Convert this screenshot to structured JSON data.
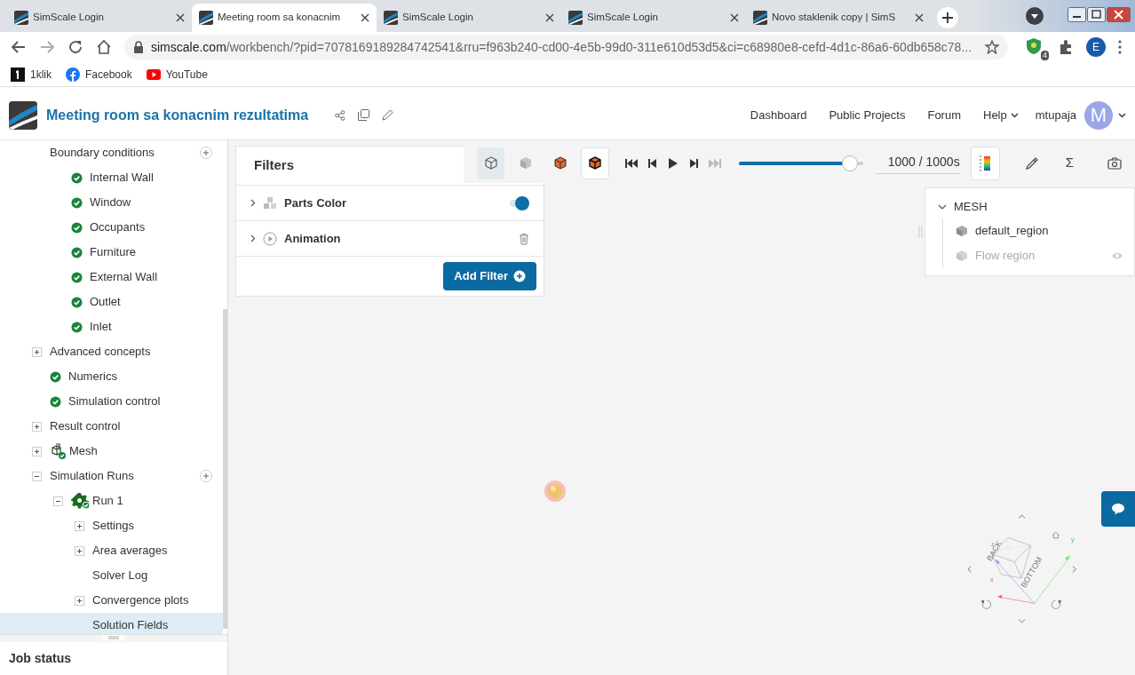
{
  "browser": {
    "tabs": [
      {
        "title": "SimScale Login",
        "selected": false
      },
      {
        "title": "Meeting room sa konacnim",
        "selected": true
      },
      {
        "title": "SimScale Login",
        "selected": false
      },
      {
        "title": "SimScale Login",
        "selected": false
      },
      {
        "title": "Novo staklenik copy | SimS",
        "selected": false
      }
    ],
    "url": "simscale.com/workbench/?pid=7078169189284742541&rru=f963b240-cd00-4e5b-99d0-311e610d53d5&ci=c68980e8-cefd-4d1c-86a6-60db658c78...",
    "extension_badge": "4",
    "profile_initial": "E",
    "bookmarks": [
      {
        "kind": "klik",
        "label": "1klik"
      },
      {
        "kind": "facebook",
        "label": "Facebook"
      },
      {
        "kind": "youtube",
        "label": "YouTube"
      }
    ]
  },
  "header": {
    "project_title": "Meeting room sa konacnim rezultatima",
    "nav": [
      {
        "label": "Dashboard",
        "dropdown": false
      },
      {
        "label": "Public Projects",
        "dropdown": false
      },
      {
        "label": "Forum",
        "dropdown": false
      },
      {
        "label": "Help",
        "dropdown": true
      }
    ],
    "username": "mtupaja",
    "avatar_initial": "M"
  },
  "sidebar": {
    "tree": [
      {
        "label": "Boundary conditions",
        "add_button": true,
        "selected": false,
        "children": [
          {
            "label": "Internal Wall",
            "kind": "done",
            "selected": false
          },
          {
            "label": "Window",
            "kind": "done",
            "selected": false
          },
          {
            "label": "Occupants",
            "kind": "done",
            "selected": false
          },
          {
            "label": "Furniture",
            "kind": "done",
            "selected": false
          },
          {
            "label": "External Wall",
            "kind": "done",
            "selected": false
          },
          {
            "label": "Outlet",
            "kind": "done",
            "selected": false
          },
          {
            "label": "Inlet",
            "kind": "done",
            "selected": false
          }
        ]
      },
      {
        "label": "Advanced concepts",
        "expanded": false,
        "selected": false
      },
      {
        "label": "Numerics",
        "kind": "done",
        "selected": false
      },
      {
        "label": "Simulation control",
        "kind": "done",
        "selected": false
      },
      {
        "label": "Result control",
        "expanded": false,
        "selected": false
      },
      {
        "label": "Mesh",
        "kind": "mesh",
        "expanded": false,
        "selected": false
      },
      {
        "label": "Simulation Runs",
        "expanded": true,
        "add_button": true,
        "selected": false,
        "children": [
          {
            "label": "Run 1",
            "kind": "run",
            "expanded": true,
            "selected": false,
            "children": [
              {
                "label": "Settings",
                "expanded": false,
                "selected": false
              },
              {
                "label": "Area averages",
                "expanded": false,
                "selected": false
              },
              {
                "label": "Solver Log",
                "selected": false
              },
              {
                "label": "Convergence plots",
                "expanded": false,
                "selected": false
              },
              {
                "label": "Solution Fields",
                "selected": true
              }
            ]
          }
        ]
      }
    ],
    "job_status_title": "Job status"
  },
  "filters": {
    "title": "Filters",
    "items": [
      {
        "kind": "parts_color",
        "label": "Parts Color",
        "on": true
      },
      {
        "kind": "animation",
        "label": "Animation"
      }
    ],
    "add_button": "Add Filter"
  },
  "toolbar": {
    "views": [
      {
        "kind": "wireframe",
        "selected": true
      },
      {
        "kind": "solid",
        "selected": false
      },
      {
        "kind": "orange",
        "selected": false
      },
      {
        "kind": "orange_edges",
        "selected": true
      }
    ],
    "playback": {
      "level": 0.955,
      "time": "1000 / 1000s"
    },
    "sigma": "Σ"
  },
  "mesh_panel": {
    "title": "MESH",
    "expanded": true,
    "regions": [
      {
        "label": "default_region",
        "visible": true
      },
      {
        "label": "Flow region",
        "visible": false
      }
    ]
  },
  "orientation_cube": {
    "faces": [
      "BACK",
      "BOTTOM"
    ],
    "axes": [
      "x",
      "y",
      "z"
    ]
  }
}
